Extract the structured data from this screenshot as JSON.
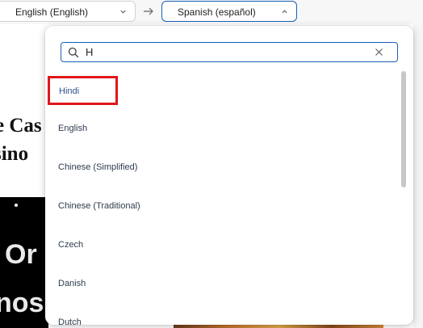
{
  "topbar": {
    "source_language": "English (English)",
    "target_language": "Spanish (español)"
  },
  "background": {
    "headline_line1": "e Cas",
    "headline_line2": "sino",
    "image_text_line1": "Or",
    "image_text_line2": "nos"
  },
  "dropdown": {
    "search_value": "H",
    "items": [
      {
        "label": "Hindi"
      },
      {
        "label": "English"
      },
      {
        "label": "Chinese (Simplified)"
      },
      {
        "label": "Chinese (Traditional)"
      },
      {
        "label": "Czech"
      },
      {
        "label": "Danish"
      },
      {
        "label": "Dutch"
      }
    ]
  },
  "colors": {
    "accent": "#1a5fb4",
    "highlight_border": "#e0161b"
  }
}
